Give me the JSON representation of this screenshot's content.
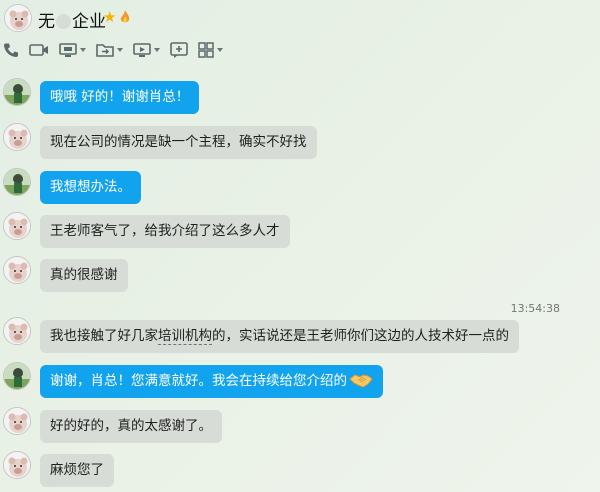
{
  "header": {
    "title_prefix": "无",
    "title_suffix": "企业",
    "star_icon": "★"
  },
  "toolbar": {
    "items": [
      "phone-icon",
      "video-call-icon",
      "screen-share-icon",
      "transfer-file-icon",
      "remote-desktop-icon",
      "add-member-icon",
      "apps-grid-icon"
    ]
  },
  "colors": {
    "mine_bubble": "#12a3ee",
    "their_bubble": "#d7dcd6",
    "background": "#e6efe4"
  },
  "messages": [
    {
      "sender": "me",
      "text": "哦哦  好的！谢谢肖总！"
    },
    {
      "sender": "them",
      "text": "现在公司的情况是缺一个主程，确实不好找"
    },
    {
      "sender": "me",
      "text": "我想想办法。"
    },
    {
      "sender": "them",
      "text": "王老师客气了，给我介绍了这么多人才"
    },
    {
      "sender": "them",
      "text": "真的很感谢"
    },
    {
      "sender": "them",
      "text_before": "我也接触了好几家",
      "text_underlined": "培训机构",
      "text_after": "的，实话说还是王老师你们这边的人技术好一点的"
    },
    {
      "sender": "me",
      "text": "谢谢，肖总！您满意就好。我会在持续给您介绍的"
    },
    {
      "sender": "them",
      "text": "好的好的，真的太感谢了。"
    },
    {
      "sender": "them",
      "text": "麻烦您了"
    }
  ],
  "timestamp": "13:54:38"
}
